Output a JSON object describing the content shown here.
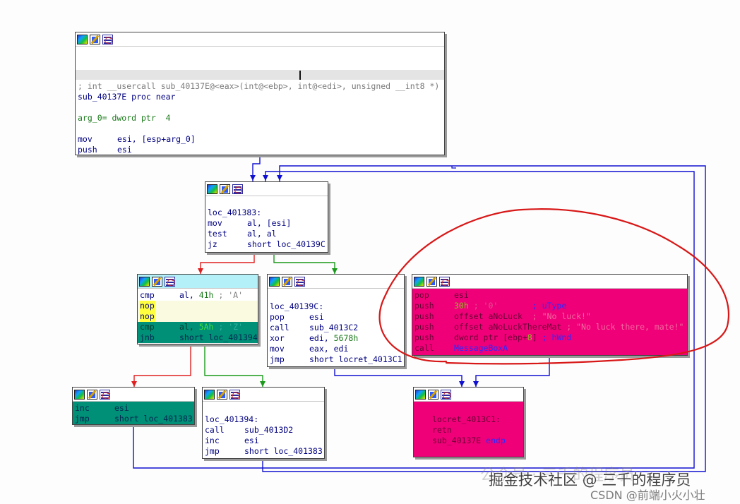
{
  "node_main": {
    "lines": [
      "; int __usercall sub_40137E@<eax>(int@<ebp>, int@<edi>, unsigned __int8 *)",
      "sub_40137E proc near",
      "arg_0= dword ptr  4",
      "esi, [esp+arg_0]",
      "esi"
    ],
    "mnemonics": [
      "mov",
      "push"
    ]
  },
  "node_loop": {
    "label": "loc_401383:",
    "mnemonics": [
      "mov",
      "test",
      "jz"
    ],
    "operands": [
      "al, [esi]",
      "al, al",
      "short loc_40139C"
    ]
  },
  "node_cmp": {
    "mnemonics": [
      "cmp",
      "nop",
      "nop",
      "cmp",
      "jnb"
    ],
    "op0_a": "al, ",
    "op0_b": "41h",
    "op0_c": " ; 'A'",
    "op3_a": "al, ",
    "op3_b": "5Ah",
    "op3_c": " ; 'Z'",
    "op4": "short loc_401394"
  },
  "node_9c": {
    "label": "loc_40139C:",
    "mnemonics": [
      "pop",
      "call",
      "xor",
      "mov",
      "jmp"
    ],
    "operands": [
      "esi",
      "sub_4013C2",
      "edi, ",
      "eax, edi",
      "short locret_4013C1"
    ],
    "op2_const": "5678h"
  },
  "node_msgbox": {
    "mnemonics": [
      "pop",
      "push",
      "push",
      "push",
      "push",
      "call"
    ],
    "op0": "esi",
    "op1_a": "30h",
    "op1_b": " ; '0'",
    "op1_c": "       ; uType",
    "op2_a": "offset aNoLuck",
    "op2_b": "  ; \"No luck!\"",
    "op3_a": "offset aNoLuckThereMat",
    "op3_b": " ; \"No luck there, mate!\"",
    "op4_a": "dword ptr [ebp+",
    "op4_b": "8",
    "op4_c": "]",
    "op4_d": " ; hWnd",
    "op5": "MessageBoxA"
  },
  "node_inc": {
    "mnemonics": [
      "inc",
      "jmp"
    ],
    "operands": [
      "esi",
      "short loc_401383"
    ]
  },
  "node_394": {
    "label": "loc_401394:",
    "mnemonics": [
      "call",
      "inc",
      "jmp"
    ],
    "operands": [
      "sub_4013D2",
      "esi",
      "short loc_401383"
    ]
  },
  "node_ret": {
    "label": "locret_4013C1:",
    "ret": "retn",
    "endp_a": "sub_40137E ",
    "endp_b": "endp"
  },
  "watermark": {
    "text1": "公众号 · 三千的程序员",
    "text2": "掘金技术社区 @ 三千的程序员",
    "text3": "CSDN @前端小火小壮"
  },
  "colors": {
    "edge_true": "#1a9a1a",
    "edge_false": "#e02020",
    "edge_loop": "#1010d0",
    "annotation": "#d81818",
    "msgbox_bg": "#f00078",
    "inc_bg": "#008f77"
  }
}
